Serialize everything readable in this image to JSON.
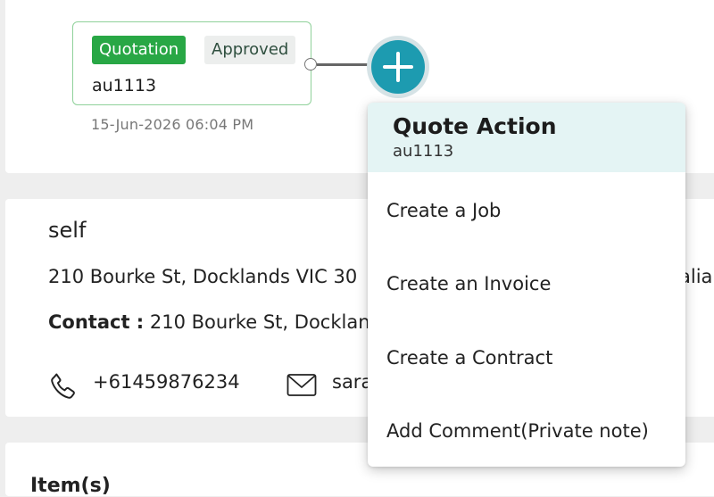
{
  "timeline": {
    "stage": {
      "badge": "Quotation",
      "status": "Approved",
      "number": "au1113",
      "date": "15-Jun-2026 06:04 PM"
    },
    "add_button_icon": "plus-icon"
  },
  "customer": {
    "name": "self",
    "address": "210 Bourke St, Docklands VIC 30",
    "address_tail": "alia",
    "contact_label": "Contact :",
    "contact_value": "210 Bourke St, Docklan",
    "phone": "+61459876234",
    "email": "sara",
    "icons": {
      "phone": "phone-icon",
      "email": "mail-icon"
    }
  },
  "items": {
    "heading": "Item(s)"
  },
  "menu": {
    "title": "Quote Action",
    "subtitle": "au1113",
    "items": [
      "Create a Job",
      "Create an Invoice",
      "Create a Contract",
      "Add Comment(Private note)"
    ]
  },
  "colors": {
    "quotation_badge": "#28a745",
    "approved_badge": "#eceeed",
    "stage_border": "#8fd19a",
    "add_button": "#1d9bb0",
    "menu_header": "#e4f4f4",
    "page_background": "#eeeeee"
  }
}
